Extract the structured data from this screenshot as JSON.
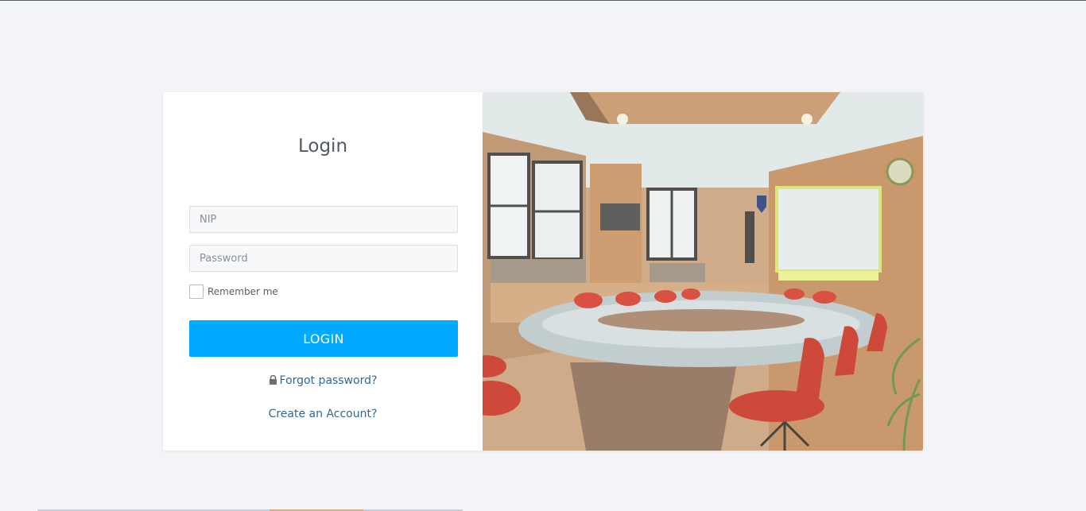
{
  "login": {
    "title": "Login",
    "nip_placeholder": "NIP",
    "password_placeholder": "Password",
    "remember_label": "Remember me",
    "button_label": "LOGIN",
    "forgot_label": "Forgot password?",
    "create_label": "Create an Account?"
  },
  "colors": {
    "page_background": "#f2f4f8",
    "button": "#00aaff",
    "link": "#2d6a99"
  },
  "icons": {
    "forgot": "lock-icon"
  },
  "image": {
    "subject": "conference-room-interior"
  }
}
